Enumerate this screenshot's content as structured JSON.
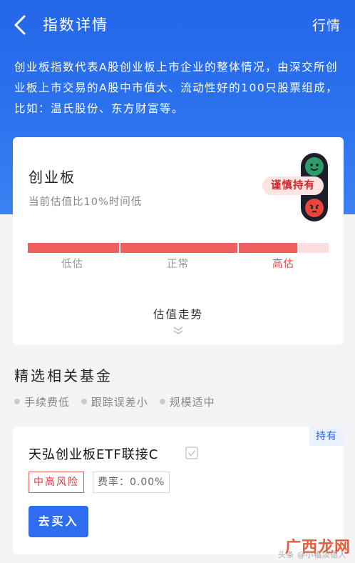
{
  "nav": {
    "title": "指数详情",
    "right_label": "行情"
  },
  "intro": "创业板指数代表A股创业板上市企业的整体情况，由深交所创业板上市交易的A股中市值大、流动性好的100只股票组成，比如：温氏股份、东方财富等。",
  "valuation": {
    "title": "创业板",
    "subtitle": "当前估值比10%时间低",
    "badge": "谨慎持有",
    "labels": {
      "low": "低估",
      "normal": "正常",
      "high": "高估"
    },
    "trend_label": "估值走势"
  },
  "section": {
    "title": "精选相关基金",
    "tags": [
      "手续费低",
      "跟踪误差小",
      "规模适中"
    ]
  },
  "fund": {
    "hold_tag": "持有",
    "name": "天弘创业板ETF联接C",
    "risk": "中高风险",
    "fee": "费率：0.00%",
    "buy_label": "去买入"
  },
  "watermark": {
    "logo": "广西龙网",
    "sub": "头条 @小福淡德人"
  },
  "colors": {
    "primary": "#2e6cf0",
    "danger": "#e84b4b",
    "hero": "#2466e8"
  }
}
